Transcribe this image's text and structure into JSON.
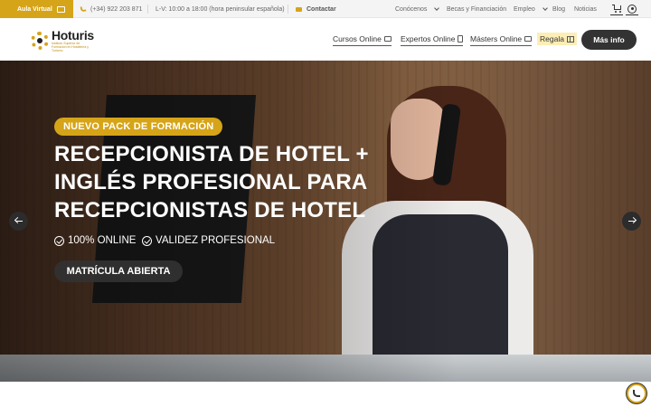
{
  "topbar": {
    "aula_virtual": "Aula Virtual",
    "phone": "(+34) 922 203 871",
    "hours": "L-V: 10:00 a 18:00 (hora peninsular española)",
    "contact": "Contactar",
    "links": [
      "Conócenos",
      "Becas y Financiación",
      "Empleo",
      "Blog",
      "Noticias"
    ],
    "icons": [
      "mortarboard-icon",
      "phone-icon",
      "mail-icon",
      "cart-icon",
      "user-icon"
    ]
  },
  "header": {
    "logo_name": "Hoturis",
    "logo_tagline": "Instituto Superior de Formación en Hostelería y Turismo",
    "nav": [
      "Cursos Online",
      "Expertos Online",
      "Másters Online"
    ],
    "regala": "Regala",
    "mas_info": "Más info"
  },
  "hero": {
    "badge": "NUEVO PACK DE FORMACIÓN",
    "title": "RECEPCIONISTA DE HOTEL + INGLÉS PROFESIONAL PARA RECEPCIONISTAS DE HOTEL",
    "features": [
      "100% ONLINE",
      "VALIDEZ PROFESIONAL"
    ],
    "cta": "MATRÍCULA ABIERTA"
  },
  "colors": {
    "accent": "#d6a418",
    "dark": "#333333",
    "topbar_bg": "#f4f4f4"
  }
}
